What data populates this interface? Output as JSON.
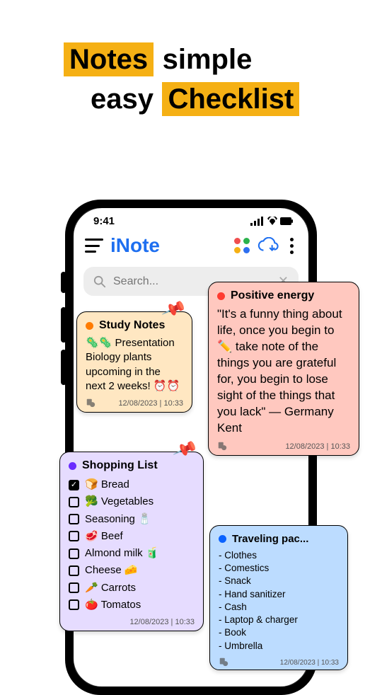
{
  "marketing": {
    "w1": "Notes",
    "w2": "simple",
    "w3": "easy",
    "w4": "Checklist"
  },
  "status": {
    "time": "9:41"
  },
  "app": {
    "title": "iNote"
  },
  "search": {
    "placeholder": "Search..."
  },
  "notes": {
    "study": {
      "title": "Study Notes",
      "body": "🦠🦠 Presentation Biology plants upcoming in the next 2 weeks! ⏰⏰",
      "timestamp": "12/08/2023 | 10:33",
      "dot_color": "#ff7b00"
    },
    "positive": {
      "title": "Positive energy",
      "body": "\"It's a funny thing about life, once you begin to ✏️ take note of the things you are grateful for, you begin to lose sight of the things that you lack\" ― Germany Kent",
      "timestamp": "12/08/2023 | 10:33",
      "dot_color": "#ff3b30"
    },
    "shopping": {
      "title": "Shopping List",
      "timestamp": "12/08/2023 | 10:33",
      "dot_color": "#6a2cff",
      "items": [
        {
          "checked": true,
          "label": "🍞 Bread"
        },
        {
          "checked": false,
          "label": "🥦 Vegetables"
        },
        {
          "checked": false,
          "label": "Seasoning 🧂"
        },
        {
          "checked": false,
          "label": "🥩 Beef"
        },
        {
          "checked": false,
          "label": "Almond milk 🧃"
        },
        {
          "checked": false,
          "label": "Cheese 🧀"
        },
        {
          "checked": false,
          "label": "🥕 Carrots"
        },
        {
          "checked": false,
          "label": "🍅 Tomatos"
        }
      ]
    },
    "travel": {
      "title": "Traveling pac...",
      "timestamp": "12/08/2023 | 10:33",
      "dot_color": "#0a62ff",
      "lines": [
        "- Clothes",
        "- Comestics",
        "- Snack",
        "- Hand sanitizer",
        "- Cash",
        "- Laptop & charger",
        "- Book",
        "- Umbrella"
      ]
    }
  }
}
